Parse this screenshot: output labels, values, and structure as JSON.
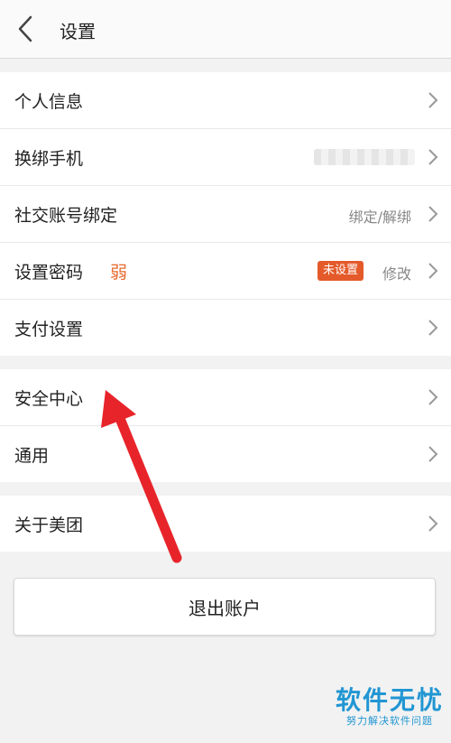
{
  "header": {
    "title": "设置"
  },
  "groups": {
    "account": {
      "personal_info": {
        "label": "个人信息"
      },
      "phone": {
        "label": "换绑手机"
      },
      "social": {
        "label": "社交账号绑定",
        "value": "绑定/解绑"
      },
      "password": {
        "label": "设置密码",
        "strength": "弱",
        "badge": "未设置",
        "action": "修改"
      },
      "payment": {
        "label": "支付设置"
      }
    },
    "security": {
      "security_center": {
        "label": "安全中心"
      },
      "general": {
        "label": "通用"
      }
    },
    "about": {
      "label": "关于美团"
    }
  },
  "logout": {
    "label": "退出账户"
  },
  "watermark": {
    "main": "软件无忧",
    "sub": "努力解决软件问题"
  },
  "colors": {
    "accent_orange": "#e7682c",
    "badge_red": "#e45a2a",
    "arrow_red": "#e8242b",
    "watermark_blue": "#2196d3"
  },
  "icons": {
    "back": "chevron-left-icon",
    "row": "chevron-right-icon"
  }
}
